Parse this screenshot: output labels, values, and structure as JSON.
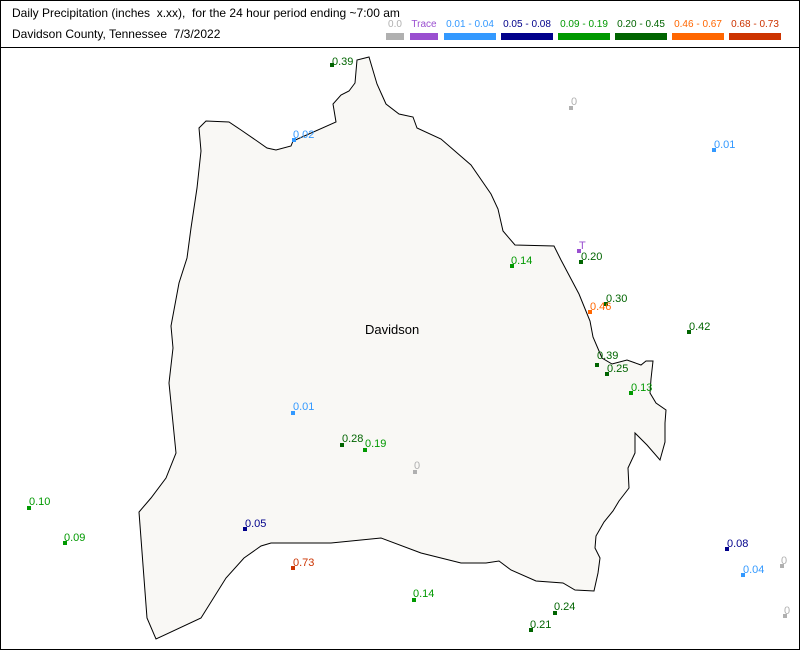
{
  "header": {
    "title_line1": "Daily Precipitation (inches  x.xx),  for the 24 hour period ending ~7:00 am",
    "title_line2": "Davidson County, Tennessee  7/3/2022"
  },
  "legend": [
    {
      "label": "0.0",
      "color": "#b0b0b0"
    },
    {
      "label": "Trace",
      "color": "#9a4fd0"
    },
    {
      "label": "0.01 - 0.04",
      "color": "#3399ff"
    },
    {
      "label": "0.05 - 0.08",
      "color": "#00008b"
    },
    {
      "label": "0.09 - 0.19",
      "color": "#009900"
    },
    {
      "label": "0.20 - 0.45",
      "color": "#006400"
    },
    {
      "label": "0.46 - 0.67",
      "color": "#ff6600"
    },
    {
      "label": "0.68 - 0.73",
      "color": "#cc3300"
    }
  ],
  "map": {
    "county_name": "Davidson",
    "stations": [
      {
        "value": "0.39",
        "color": "#006400"
      },
      {
        "value": "0",
        "color": "#b0b0b0"
      },
      {
        "value": "0.02",
        "color": "#3399ff"
      },
      {
        "value": "0.01",
        "color": "#3399ff"
      },
      {
        "value": "T",
        "color": "#9a4fd0"
      },
      {
        "value": "0.14",
        "color": "#009900"
      },
      {
        "value": "0.20",
        "color": "#006400"
      },
      {
        "value": "0.30",
        "color": "#006400"
      },
      {
        "value": "0.46",
        "color": "#ff6600"
      },
      {
        "value": "0.42",
        "color": "#006400"
      },
      {
        "value": "0.39",
        "color": "#006400"
      },
      {
        "value": "0.25",
        "color": "#006400"
      },
      {
        "value": "0.13",
        "color": "#009900"
      },
      {
        "value": "0.01",
        "color": "#3399ff"
      },
      {
        "value": "0.28",
        "color": "#006400"
      },
      {
        "value": "0.19",
        "color": "#009900"
      },
      {
        "value": "0",
        "color": "#b0b0b0"
      },
      {
        "value": "0.10",
        "color": "#009900"
      },
      {
        "value": "0.09",
        "color": "#009900"
      },
      {
        "value": "0.05",
        "color": "#00008b"
      },
      {
        "value": "0.73",
        "color": "#cc3300"
      },
      {
        "value": "0.08",
        "color": "#00008b"
      },
      {
        "value": "0",
        "color": "#b0b0b0"
      },
      {
        "value": "0.04",
        "color": "#3399ff"
      },
      {
        "value": "0",
        "color": "#b0b0b0"
      },
      {
        "value": "0.14",
        "color": "#009900"
      },
      {
        "value": "0.24",
        "color": "#006400"
      },
      {
        "value": "0.21",
        "color": "#006400"
      }
    ]
  }
}
